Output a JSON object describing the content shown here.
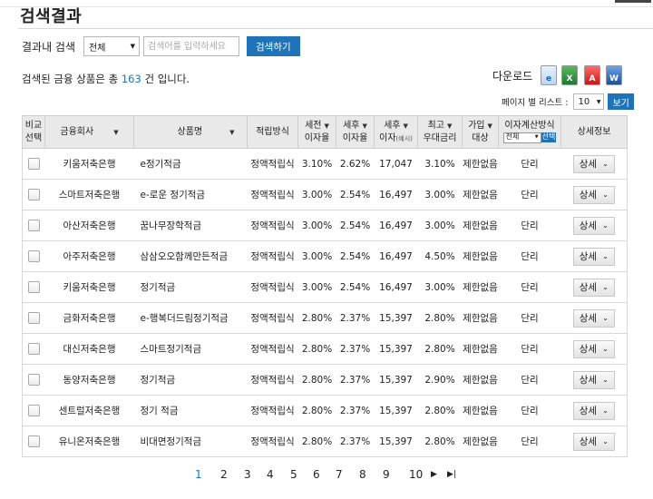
{
  "page": {
    "title": "검색결과"
  },
  "search": {
    "label": "결과내 검색",
    "scope": "전체",
    "placeholder": "검색어를 입력하세요",
    "button": "검색하기"
  },
  "summary": {
    "prefix": "검색된 금융 상품은 총",
    "count": "163",
    "suffix": "건 입니다."
  },
  "download": {
    "label": "다운로드",
    "icons": [
      "ie-icon",
      "excel-icon",
      "pdf-icon",
      "word-icon"
    ]
  },
  "perpage": {
    "label": "페이지 별 리스트 :",
    "value": "10",
    "button": "보기"
  },
  "table": {
    "headers": {
      "compare": [
        "비교",
        "선택"
      ],
      "company": "금융회사",
      "product": "상품명",
      "method": "적립방식",
      "pretax": [
        "세전",
        "이자율"
      ],
      "posttax": [
        "세후",
        "이자율"
      ],
      "interest": [
        "세후",
        "이자",
        "(예시)"
      ],
      "max": [
        "최고",
        "우대금리"
      ],
      "target": [
        "가입",
        "대상"
      ],
      "calc": {
        "label": "이자계산방식",
        "select": "전체",
        "button": "선택"
      },
      "detail": "상세정보"
    },
    "detail_label": "상세",
    "rows": [
      {
        "company": "키움저축은행",
        "product": "e정기적금",
        "method": "정액적립식",
        "pretax": "3.10%",
        "posttax": "2.62%",
        "interest": "17,047",
        "max": "3.10%",
        "target": "제한없음",
        "calc": "단리"
      },
      {
        "company": "스마트저축은행",
        "product": "e-로운 정기적금",
        "method": "정액적립식",
        "pretax": "3.00%",
        "posttax": "2.54%",
        "interest": "16,497",
        "max": "3.00%",
        "target": "제한없음",
        "calc": "단리"
      },
      {
        "company": "아산저축은행",
        "product": "꿈나무장학적금",
        "method": "정액적립식",
        "pretax": "3.00%",
        "posttax": "2.54%",
        "interest": "16,497",
        "max": "3.00%",
        "target": "제한없음",
        "calc": "단리"
      },
      {
        "company": "아주저축은행",
        "product": "삼삼오오함께만든적금",
        "method": "정액적립식",
        "pretax": "3.00%",
        "posttax": "2.54%",
        "interest": "16,497",
        "max": "4.50%",
        "target": "제한없음",
        "calc": "단리"
      },
      {
        "company": "키움저축은행",
        "product": "정기적금",
        "method": "정액적립식",
        "pretax": "3.00%",
        "posttax": "2.54%",
        "interest": "16,497",
        "max": "3.00%",
        "target": "제한없음",
        "calc": "단리"
      },
      {
        "company": "금화저축은행",
        "product": "e-행복더드림정기적금",
        "method": "정액적립식",
        "pretax": "2.80%",
        "posttax": "2.37%",
        "interest": "15,397",
        "max": "2.80%",
        "target": "제한없음",
        "calc": "단리"
      },
      {
        "company": "대신저축은행",
        "product": "스마트정기적금",
        "method": "정액적립식",
        "pretax": "2.80%",
        "posttax": "2.37%",
        "interest": "15,397",
        "max": "2.80%",
        "target": "제한없음",
        "calc": "단리"
      },
      {
        "company": "동양저축은행",
        "product": "정기적금",
        "method": "정액적립식",
        "pretax": "2.80%",
        "posttax": "2.37%",
        "interest": "15,397",
        "max": "2.90%",
        "target": "제한없음",
        "calc": "단리"
      },
      {
        "company": "센트럴저축은행",
        "product": "정기 적금",
        "method": "정액적립식",
        "pretax": "2.80%",
        "posttax": "2.37%",
        "interest": "15,397",
        "max": "2.80%",
        "target": "제한없음",
        "calc": "단리"
      },
      {
        "company": "유니온저축은행",
        "product": "비대면정기적금",
        "method": "정액적립식",
        "pretax": "2.80%",
        "posttax": "2.37%",
        "interest": "15,397",
        "max": "2.80%",
        "target": "제한없음",
        "calc": "단리"
      }
    ]
  },
  "pagination": {
    "pages": [
      "1",
      "2",
      "3",
      "4",
      "5",
      "6",
      "7",
      "8",
      "9",
      "10"
    ],
    "current": "1"
  },
  "colors": {
    "accent": "#1f73b8",
    "header_bg": "#e9e9e9",
    "border": "#cfcfcf"
  }
}
